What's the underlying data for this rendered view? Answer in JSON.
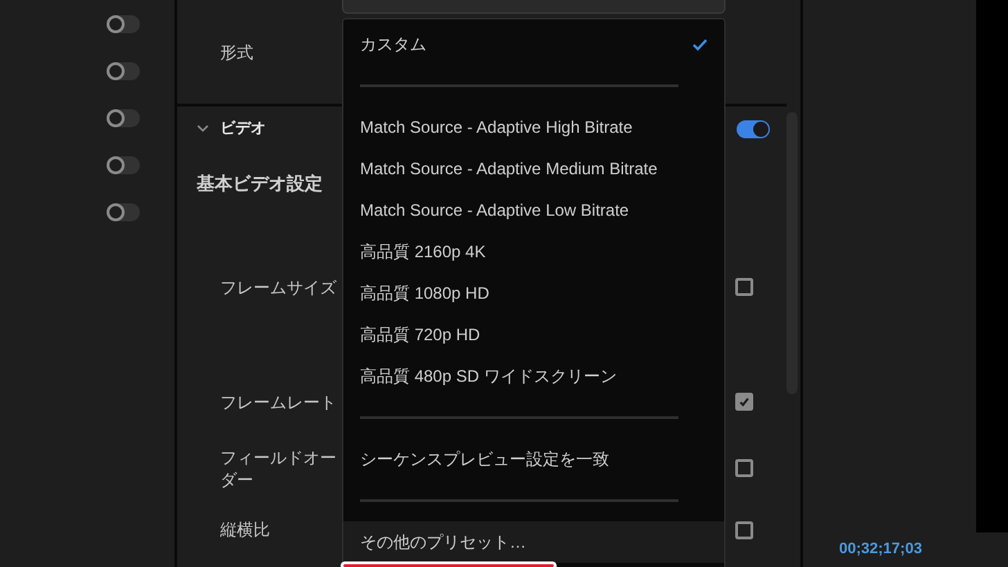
{
  "left_panel": {
    "toggles": [
      {
        "on": false
      },
      {
        "on": false
      },
      {
        "on": false
      },
      {
        "on": false
      },
      {
        "on": false
      }
    ]
  },
  "settings": {
    "top_label": "形式",
    "video_section": {
      "title": "ビデオ",
      "expanded": true,
      "on": true
    },
    "heading": "基本ビデオ設定",
    "rows": [
      {
        "label": "フレームサイズ",
        "kind": "checkbox",
        "checked": false
      },
      {
        "label": "フレームレート",
        "kind": "checkbox",
        "checked": true
      },
      {
        "label": "フィールドオーダー",
        "kind": "checkbox",
        "checked": false
      },
      {
        "label": "縦横比",
        "kind": "checkbox",
        "checked": false
      }
    ]
  },
  "preset_menu": {
    "items": [
      {
        "kind": "option",
        "label": "カスタム",
        "selected": true,
        "highlighted": false
      },
      {
        "kind": "separator"
      },
      {
        "kind": "option",
        "label": "Match Source - Adaptive High Bitrate",
        "selected": false,
        "highlighted": false
      },
      {
        "kind": "option",
        "label": "Match Source - Adaptive Medium Bitrate",
        "selected": false,
        "highlighted": false
      },
      {
        "kind": "option",
        "label": "Match Source - Adaptive Low Bitrate",
        "selected": false,
        "highlighted": false
      },
      {
        "kind": "option",
        "label": "高品質 2160p 4K",
        "selected": false,
        "highlighted": false
      },
      {
        "kind": "option",
        "label": "高品質 1080p HD",
        "selected": false,
        "highlighted": false
      },
      {
        "kind": "option",
        "label": "高品質 720p HD",
        "selected": false,
        "highlighted": false
      },
      {
        "kind": "option",
        "label": "高品質 480p SD ワイドスクリーン",
        "selected": false,
        "highlighted": false
      },
      {
        "kind": "separator"
      },
      {
        "kind": "option",
        "label": "シーケンスプレビュー設定を一致",
        "selected": false,
        "highlighted": false
      },
      {
        "kind": "separator"
      },
      {
        "kind": "option",
        "label": "その他のプリセット…",
        "selected": false,
        "highlighted": true
      }
    ]
  },
  "timecode": "00;32;17;03"
}
